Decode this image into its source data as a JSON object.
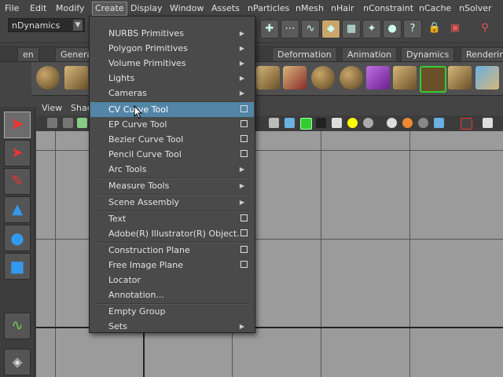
{
  "menubar": {
    "items": [
      "File",
      "Edit",
      "Modify",
      "Create",
      "Display",
      "Window",
      "Assets",
      "nParticles",
      "nMesh",
      "nHair",
      "nConstraint",
      "nCache",
      "nSolver"
    ],
    "active": "Create"
  },
  "mode_selector": {
    "value": "nDynamics"
  },
  "shelf_tabs": {
    "left": [
      "en",
      "Genera"
    ],
    "right": [
      "Deformation",
      "Animation",
      "Dynamics",
      "Rendering"
    ]
  },
  "panel_menu": {
    "view": "View",
    "shading": "Shac"
  },
  "create_menu": {
    "items": [
      {
        "label": "NURBS Primitives",
        "submenu": true
      },
      {
        "label": "Polygon Primitives",
        "submenu": true
      },
      {
        "label": "Volume Primitives",
        "submenu": true
      },
      {
        "label": "Lights",
        "submenu": true
      },
      {
        "label": "Cameras",
        "submenu": true
      },
      {
        "label": "CV Curve Tool",
        "option_box": true,
        "highlighted": true
      },
      {
        "label": "EP Curve Tool",
        "option_box": true
      },
      {
        "label": "Bezier Curve Tool",
        "option_box": true
      },
      {
        "label": "Pencil Curve Tool",
        "option_box": true
      },
      {
        "label": "Arc Tools",
        "submenu": true
      },
      {
        "label": "Measure Tools",
        "submenu": true
      },
      {
        "label": "Scene Assembly",
        "submenu": true
      },
      {
        "label": "Text",
        "option_box": true
      },
      {
        "label": "Adobe(R) Illustrator(R) Object...",
        "option_box": true
      },
      {
        "label": "Construction Plane",
        "option_box": true
      },
      {
        "label": "Free Image Plane",
        "option_box": true
      },
      {
        "label": "Locator"
      },
      {
        "label": "Annotation..."
      },
      {
        "label": "Empty Group"
      },
      {
        "label": "Sets",
        "submenu": true
      }
    ]
  },
  "icons": {
    "submenu_arrow": "▶",
    "dropdown_arrow": "▼"
  }
}
